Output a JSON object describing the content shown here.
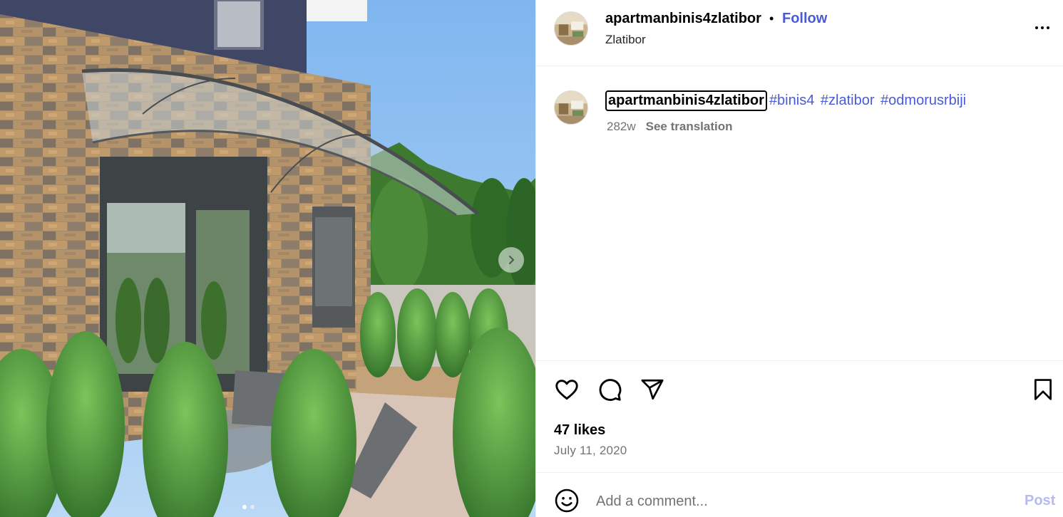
{
  "post": {
    "username": "apartmanbinis4zlatibor",
    "separator": "•",
    "follow_label": "Follow",
    "location": "Zlatibor",
    "more_icon": "more-horizontal-icon"
  },
  "caption": {
    "username": "apartmanbinis4zlatibor",
    "hashtags": [
      "#binis4",
      "#zlatibor",
      "#odmorusrbiji"
    ],
    "age": "282w",
    "see_translation": "See translation"
  },
  "actions": {
    "like_icon": "heart-icon",
    "comment_icon": "comment-icon",
    "share_icon": "share-icon",
    "save_icon": "bookmark-icon"
  },
  "stats": {
    "likes": "47 likes",
    "date": "July 11, 2020"
  },
  "comment": {
    "emoji_icon": "emoji-icon",
    "placeholder": "Add a comment...",
    "post_label": "Post"
  },
  "carousel": {
    "current_index": 1,
    "total": 2
  },
  "colors": {
    "link_blue": "#4a5bd8",
    "post_disabled": "#b3bbf0",
    "muted_text": "#737373"
  }
}
